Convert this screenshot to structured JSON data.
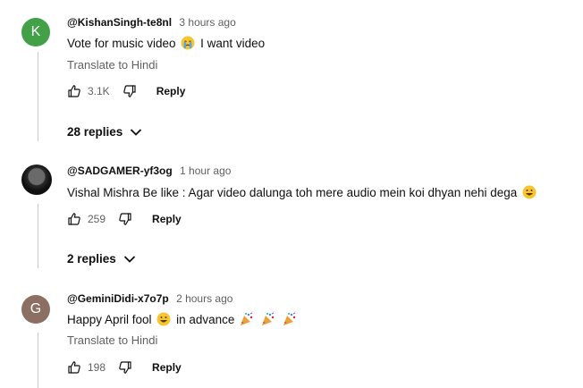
{
  "colors": {
    "avatar_k": "#43a047",
    "avatar_g": "#8d6e63",
    "muted_text": "#606060"
  },
  "comments": [
    {
      "avatar_letter": "K",
      "handle": "@KishanSingh-te8nl",
      "time": "3 hours ago",
      "text_before": "Vote for music video",
      "text_after": "I want video",
      "emoji": [
        "crying-face"
      ],
      "translate": "Translate to Hindi",
      "likes": "3.1K",
      "reply_label": "Reply",
      "replies_label": "28 replies"
    },
    {
      "avatar_letter": "",
      "handle": "@SADGAMER-yf3og",
      "time": "1 hour ago",
      "text": "Vishal Mishra Be like : Agar video dalunga toh mere audio mein koi dhyan nehi dega",
      "emoji": [
        "grinning-face"
      ],
      "likes": "259",
      "reply_label": "Reply",
      "replies_label": "2 replies"
    },
    {
      "avatar_letter": "G",
      "handle": "@GeminiDidi-x7o7p",
      "time": "2 hours ago",
      "text_before": "Happy April fool",
      "text_after": "in advance",
      "emoji": [
        "grinning-face",
        "party-popper",
        "party-popper",
        "party-popper"
      ],
      "translate": "Translate to Hindi",
      "likes": "198",
      "reply_label": "Reply"
    }
  ]
}
